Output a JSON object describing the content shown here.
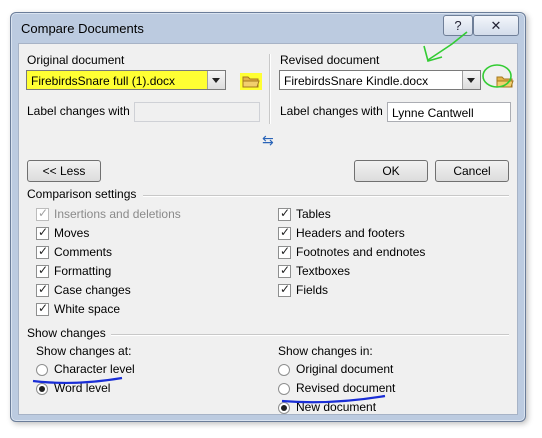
{
  "window": {
    "title": "Compare Documents",
    "help_label": "?",
    "close_label": "✕"
  },
  "original": {
    "heading": "Original document",
    "file": "FirebirdsSnare full (1).docx",
    "label_caption": "Label changes with",
    "label_value": ""
  },
  "revised": {
    "heading": "Revised document",
    "file": "FirebirdsSnare Kindle.docx",
    "label_caption": "Label changes with",
    "label_value": "Lynne Cantwell"
  },
  "buttons": {
    "less": "<< Less",
    "ok": "OK",
    "cancel": "Cancel"
  },
  "comparison": {
    "heading": "Comparison settings",
    "left": [
      {
        "label": "Insertions and deletions",
        "checked": true,
        "disabled": true
      },
      {
        "label": "Moves",
        "checked": true
      },
      {
        "label": "Comments",
        "checked": true
      },
      {
        "label": "Formatting",
        "checked": true
      },
      {
        "label": "Case changes",
        "checked": true
      },
      {
        "label": "White space",
        "checked": true
      }
    ],
    "right": [
      {
        "label": "Tables",
        "checked": true
      },
      {
        "label": "Headers and footers",
        "checked": true
      },
      {
        "label": "Footnotes and endnotes",
        "checked": true
      },
      {
        "label": "Textboxes",
        "checked": true
      },
      {
        "label": "Fields",
        "checked": true
      }
    ]
  },
  "show": {
    "heading": "Show changes",
    "at_heading": "Show changes at:",
    "at": [
      {
        "label": "Character level",
        "selected": false
      },
      {
        "label": "Word level",
        "selected": true
      }
    ],
    "in_heading": "Show changes in:",
    "in": [
      {
        "label": "Original document",
        "selected": false
      },
      {
        "label": "Revised document",
        "selected": false
      },
      {
        "label": "New document",
        "selected": true
      }
    ]
  },
  "colors": {
    "highlight_yellow": "#ffff33",
    "annotation_green": "#33cc33",
    "annotation_blue": "#1a2ed6"
  }
}
